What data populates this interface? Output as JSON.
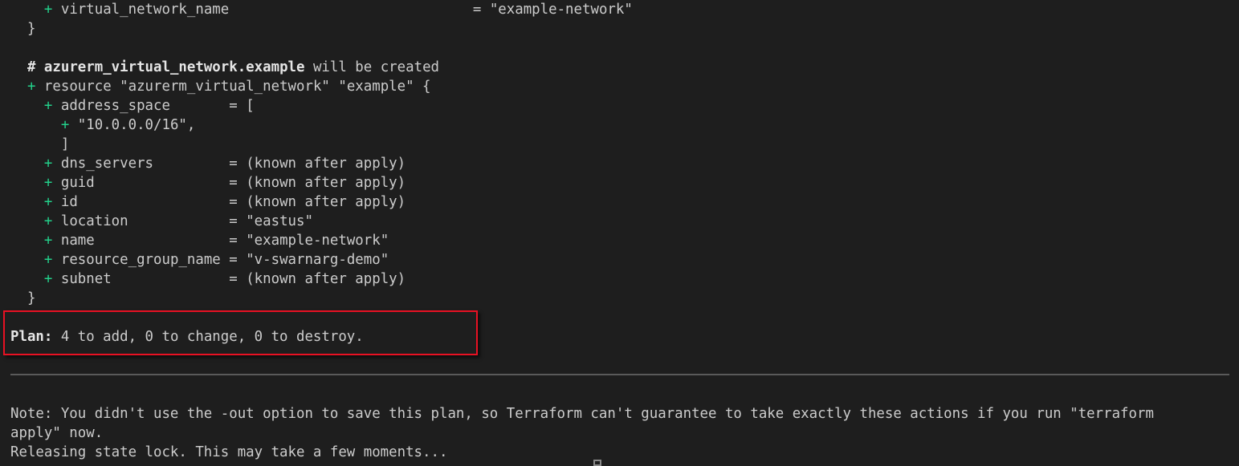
{
  "terminal": {
    "lines": [
      {
        "indent": "    ",
        "plus": "+ ",
        "key": "virtual_network_name                             ",
        "value": "= \"example-network\""
      },
      {
        "indent": "  ",
        "text": "}"
      },
      {
        "indent": "",
        "text": ""
      },
      {
        "indent": "  ",
        "comment_prefix": "# ",
        "resource_addr": "azurerm_virtual_network.example",
        "comment_suffix": " will be created"
      },
      {
        "indent": "  ",
        "plus": "+ ",
        "text": "resource \"azurerm_virtual_network\" \"example\" {"
      },
      {
        "indent": "    ",
        "plus": "+ ",
        "key": "address_space       ",
        "value": "= ["
      },
      {
        "indent": "      ",
        "plus": "+ ",
        "text": "\"10.0.0.0/16\","
      },
      {
        "indent": "    ",
        "text": "  ]"
      },
      {
        "indent": "    ",
        "plus": "+ ",
        "key": "dns_servers         ",
        "value": "= (known after apply)"
      },
      {
        "indent": "    ",
        "plus": "+ ",
        "key": "guid                ",
        "value": "= (known after apply)"
      },
      {
        "indent": "    ",
        "plus": "+ ",
        "key": "id                  ",
        "value": "= (known after apply)"
      },
      {
        "indent": "    ",
        "plus": "+ ",
        "key": "location            ",
        "value": "= \"eastus\""
      },
      {
        "indent": "    ",
        "plus": "+ ",
        "key": "name                ",
        "value": "= \"example-network\""
      },
      {
        "indent": "    ",
        "plus": "+ ",
        "key": "resource_group_name ",
        "value": "= \"v-swarnarg-demo\""
      },
      {
        "indent": "    ",
        "plus": "+ ",
        "key": "subnet              ",
        "value": "= (known after apply)"
      },
      {
        "indent": "  ",
        "text": "}"
      }
    ],
    "plan": {
      "label": "Plan:",
      "summary": " 4 to add, 0 to change, 0 to destroy."
    },
    "note_line1": "Note: You didn't use the -out option to save this plan, so Terraform can't guarantee to take exactly these actions if you run \"terraform",
    "note_line2": "apply\" now.",
    "releasing": "Releasing state lock. This may take a few moments..."
  },
  "colors": {
    "background": "#1e1e1e",
    "text": "#cccccc",
    "plus": "#23d18b",
    "highlight_border": "#e81123"
  }
}
